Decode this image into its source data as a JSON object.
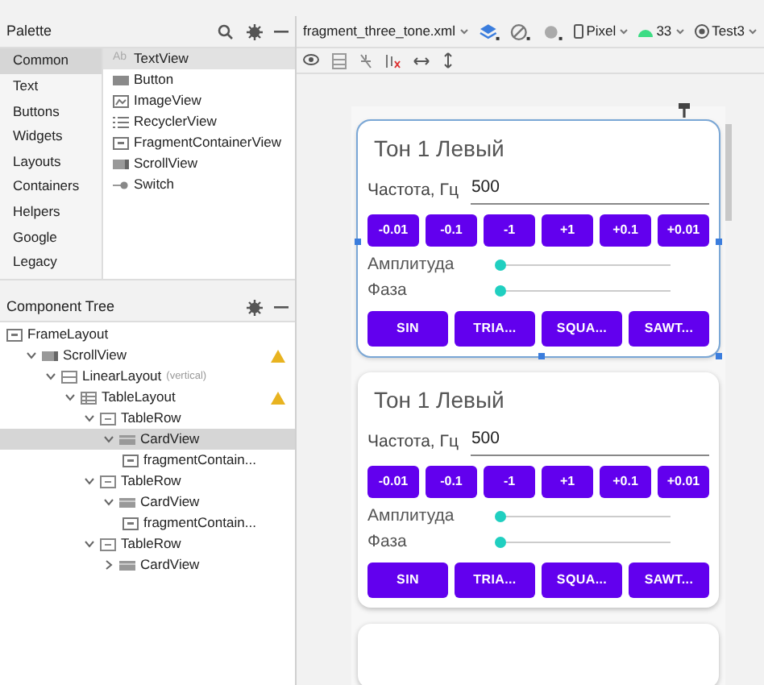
{
  "palette": {
    "title": "Palette",
    "categories": [
      {
        "label": "Common",
        "selected": true
      },
      {
        "label": "Text",
        "selected": false
      },
      {
        "label": "Buttons",
        "selected": false
      },
      {
        "label": "Widgets",
        "selected": false
      },
      {
        "label": "Layouts",
        "selected": false
      },
      {
        "label": "Containers",
        "selected": false
      },
      {
        "label": "Helpers",
        "selected": false
      },
      {
        "label": "Google",
        "selected": false
      },
      {
        "label": "Legacy",
        "selected": false
      }
    ],
    "widgets": [
      {
        "label": "TextView",
        "kind": "text",
        "icon_text": "Ab",
        "selected": true
      },
      {
        "label": "Button",
        "kind": "button",
        "selected": false
      },
      {
        "label": "ImageView",
        "kind": "image",
        "selected": false
      },
      {
        "label": "RecyclerView",
        "kind": "list",
        "selected": false
      },
      {
        "label": "FragmentContainerView",
        "kind": "frame",
        "selected": false
      },
      {
        "label": "ScrollView",
        "kind": "scroll",
        "selected": false
      },
      {
        "label": "Switch",
        "kind": "switch",
        "selected": false
      }
    ]
  },
  "component_tree": {
    "title": "Component Tree",
    "nodes": [
      {
        "label": "FrameLayout",
        "kind": "frame",
        "selected": false,
        "warning": false,
        "children": [
          {
            "label": "ScrollView",
            "kind": "scroll",
            "expanded": true,
            "selected": false,
            "warning": true,
            "children": [
              {
                "label": "LinearLayout",
                "note": "(vertical)",
                "kind": "linear",
                "expanded": true,
                "selected": false,
                "warning": false,
                "children": [
                  {
                    "label": "TableLayout",
                    "kind": "table",
                    "expanded": true,
                    "selected": false,
                    "warning": true,
                    "children": [
                      {
                        "label": "TableRow",
                        "kind": "row",
                        "expanded": true,
                        "selected": false,
                        "warning": false,
                        "children": [
                          {
                            "label": "CardView",
                            "kind": "card",
                            "expanded": true,
                            "selected": true,
                            "warning": false,
                            "children": [
                              {
                                "label": "fragmentContain...",
                                "kind": "frame",
                                "selected": false,
                                "warning": false
                              }
                            ]
                          }
                        ]
                      },
                      {
                        "label": "TableRow",
                        "kind": "row",
                        "expanded": true,
                        "selected": false,
                        "warning": false,
                        "children": [
                          {
                            "label": "CardView",
                            "kind": "card",
                            "expanded": true,
                            "selected": false,
                            "warning": false,
                            "children": [
                              {
                                "label": "fragmentContain...",
                                "kind": "frame",
                                "selected": false,
                                "warning": false
                              }
                            ]
                          }
                        ]
                      },
                      {
                        "label": "TableRow",
                        "kind": "row",
                        "expanded": true,
                        "selected": false,
                        "warning": false,
                        "children": [
                          {
                            "label": "CardView",
                            "kind": "card",
                            "expanded": false,
                            "selected": false,
                            "warning": false
                          }
                        ]
                      }
                    ]
                  }
                ]
              }
            ]
          }
        ]
      }
    ]
  },
  "toolbar": {
    "file": "fragment_three_tone.xml",
    "device": "Pixel",
    "api": "33",
    "theme": "Test3"
  },
  "cards": [
    {
      "title": "Тон 1 Левый",
      "selected": true,
      "freq_label": "Частота, Гц",
      "freq_value": "500",
      "steps": [
        "-0.01",
        "-0.1",
        "-1",
        "+1",
        "+0.1",
        "+0.01"
      ],
      "sliders": [
        {
          "label": "Амплитуда",
          "level": 0
        },
        {
          "label": "Фаза",
          "level": 0
        }
      ],
      "waves": [
        "SIN",
        "TRIA...",
        "SQUA...",
        "SAWT..."
      ]
    },
    {
      "title": "Тон 1 Левый",
      "selected": false,
      "freq_label": "Частота, Гц",
      "freq_value": "500",
      "steps": [
        "-0.01",
        "-0.1",
        "-1",
        "+1",
        "+0.1",
        "+0.01"
      ],
      "sliders": [
        {
          "label": "Амплитуда",
          "level": 0
        },
        {
          "label": "Фаза",
          "level": 0
        }
      ],
      "waves": [
        "SIN",
        "TRIA...",
        "SQUA...",
        "SAWT..."
      ]
    }
  ]
}
